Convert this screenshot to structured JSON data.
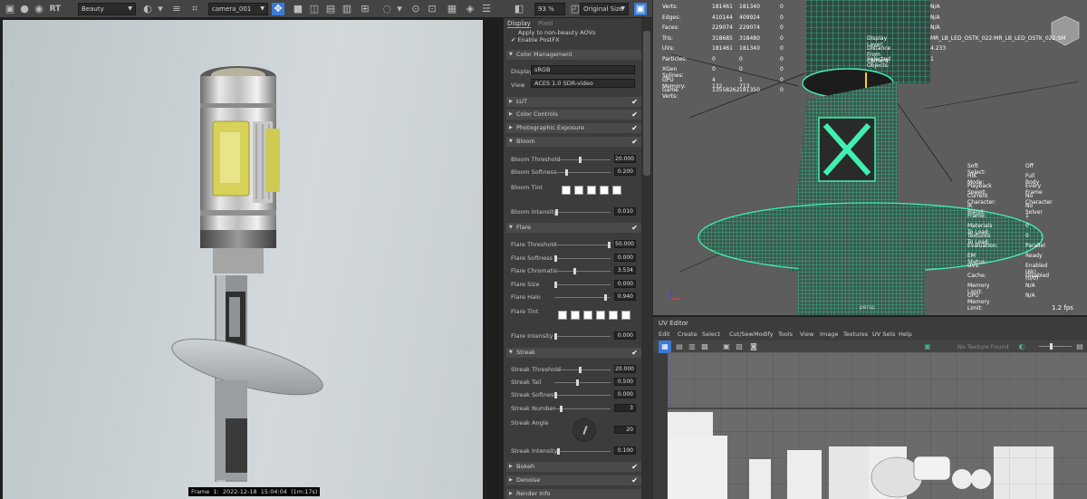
{
  "toolbar": {
    "rt_label": "RT",
    "render_pass": "Beauty",
    "camera": "camera_001",
    "zoom": "93 %",
    "size_mode": "Original Size"
  },
  "render": {
    "frame_info": "Frame  1:  2022-12-18  15:04:04  (1m:17s)"
  },
  "panel": {
    "tabs": [
      "Display",
      "Pixel"
    ],
    "apply_aovs": "Apply to non-beauty AOVs",
    "enable_postfx": "Enable PostFX",
    "color_management": {
      "title": "Color Management",
      "display_label": "Display",
      "display_value": "sRGB",
      "view_label": "View",
      "view_value": "ACES 1.0 SDR-video"
    },
    "lut": "LUT",
    "color_controls": "Color Controls",
    "photographic_exposure": "Photographic Exposure",
    "bloom": {
      "title": "Bloom",
      "threshold_label": "Bloom Threshold",
      "threshold": "20.000",
      "threshold_frac": 0.45,
      "softness_label": "Bloom Softness",
      "softness": "0.200",
      "softness_frac": 0.2,
      "tint_label": "Bloom Tint",
      "intensity_label": "Bloom Intensity",
      "intensity": "0.010",
      "intensity_frac": 0.02
    },
    "flare": {
      "title": "Flare",
      "threshold_label": "Flare Threshold",
      "threshold": "50.000",
      "threshold_frac": 1.0,
      "softness_label": "Flare Softness",
      "softness": "0.000",
      "softness_frac": 0.0,
      "chromatic_label": "Flare Chromatic",
      "chromatic": "3.534",
      "chromatic_frac": 0.35,
      "size_label": "Flare Size",
      "size": "0.000",
      "size_frac": 0.0,
      "halo_label": "Flare Halo",
      "halo": "0.940",
      "halo_frac": 0.94,
      "tint_label": "Flare Tint",
      "intensity_label": "Flare Intensity",
      "intensity": "0.000",
      "intensity_frac": 0.0
    },
    "streak": {
      "title": "Streak",
      "threshold_label": "Streak Threshold",
      "threshold": "20.000",
      "threshold_frac": 0.45,
      "tail_label": "Streak Tail",
      "tail": "0.500",
      "tail_frac": 0.4,
      "softness_label": "Streak Softness",
      "softness": "0.000",
      "softness_frac": 0.0,
      "number_label": "Streak Number",
      "number": "3",
      "number_frac": 0.1,
      "angle_label": "Streak Angle",
      "angle": "20",
      "intensity_label": "Streak Intensity",
      "intensity": "0.100",
      "intensity_frac": 0.05
    },
    "bokeh": "Bokeh",
    "denoise": "Denoise",
    "render_info": "Render Info"
  },
  "viewport": {
    "stats": [
      {
        "label": "Verts:",
        "a": "181461",
        "b": "181340",
        "c": "0"
      },
      {
        "label": "Edges:",
        "a": "410144",
        "b": "409924",
        "c": "0"
      },
      {
        "label": "Faces:",
        "a": "229074",
        "b": "229074",
        "c": "0"
      },
      {
        "label": "Tris:",
        "a": "318685",
        "b": "318480",
        "c": "0"
      },
      {
        "label": "UVs:",
        "a": "181461",
        "b": "181340",
        "c": "0"
      },
      {
        "label": "Particles:",
        "a": "0",
        "b": "0",
        "c": "0"
      },
      {
        "label": "XGen Splines:",
        "a": "0",
        "b": "0",
        "c": "0"
      },
      {
        "label": "GPU Memory:",
        "a": "4 132",
        "b": "1 713",
        "c": "0"
      },
      {
        "label": "Game Verts:",
        "a": "13558262",
        "b": "181350",
        "c": "0"
      }
    ],
    "right_stats": [
      {
        "label": "",
        "value": "N/A"
      },
      {
        "label": "",
        "value": "N/A"
      },
      {
        "label": "",
        "value": "N/A"
      },
      {
        "label": "Display Layer:",
        "value": "MR_LB_LED_OSTK_022:MR_LB_LED_OSTK_022:SM"
      },
      {
        "label": "Distance From Camera:",
        "value": "4.233"
      },
      {
        "label": "Selected Objects:",
        "value": "1"
      }
    ],
    "settings": [
      {
        "label": "Soft Select:",
        "value": "Off"
      },
      {
        "label": "HIK Mode:",
        "value": "Full Body"
      },
      {
        "label": "Playback Speed:",
        "value": "Every Frame"
      },
      {
        "label": "Current Character:",
        "value": "No Character"
      },
      {
        "label": "IK Blend:",
        "value": "No Solver"
      },
      {
        "label": "Frame:",
        "value": "1"
      },
      {
        "label": "Materials To Load:",
        "value": "0"
      },
      {
        "label": "Textures To Load:",
        "value": "0"
      },
      {
        "label": "Evaluation:",
        "value": "Parallel"
      },
      {
        "label": "EM Status:",
        "value": "Ready"
      },
      {
        "label": "UVs:",
        "value": "Enabled (6k) (0/0)"
      },
      {
        "label": "Cache:",
        "value": "Disabled"
      },
      {
        "label": "Memory Limit:",
        "value": "N/A"
      },
      {
        "label": "GPU Memory Limit:",
        "value": "N/A"
      }
    ],
    "fps": "1.2 fps",
    "camera_name": "persp"
  },
  "uv_editor": {
    "title": "UV Editor",
    "menus": [
      "Edit",
      "Create",
      "Select",
      "Cut/Sew",
      "Modify",
      "Tools",
      "View",
      "Image",
      "Textures",
      "UV Sets",
      "Help"
    ],
    "texture_status": "No Texture Found"
  },
  "colors": {
    "wire": "#40f0b0",
    "accent_blue": "#3a7bd5"
  }
}
